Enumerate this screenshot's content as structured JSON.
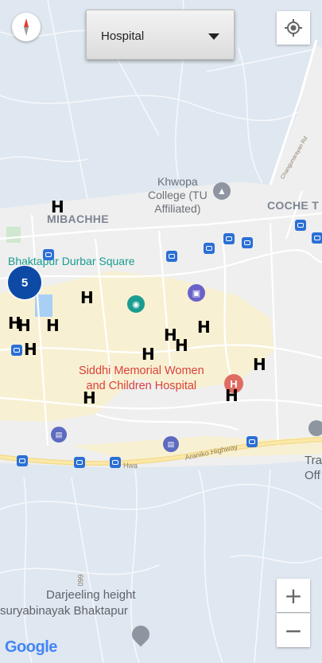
{
  "filter": {
    "selected": "Hospital"
  },
  "labels": {
    "mibachhe": "MIBACHHE",
    "coche": "COCHE T",
    "khwopa": [
      "Khwopa",
      "College (TU",
      "Affiliated)"
    ],
    "durbar": "Bhaktapur Durbar Square",
    "hospital": [
      "Siddhi Memorial Women",
      "and Children Hospital"
    ],
    "darjeeling": "Darjeeling height",
    "suryabinayak": "suryabinayak Bhaktapur",
    "tra": [
      "Tra",
      "Off"
    ],
    "araniko": "Araniko Highway",
    "changunarayan": "Changunarayan Rd",
    "hwa": "Hwa",
    "road_099": "099"
  },
  "cluster": {
    "count": "5"
  },
  "hospital_marker": "H",
  "controls": {
    "zoom_in": "+",
    "zoom_out": "−"
  },
  "attribution": "Google",
  "colors": {
    "cluster": "#0c4aa6",
    "bus_stop": "#2b6fd6",
    "teal_poi": "#1a9c90",
    "hospital_red": "#d9413b"
  }
}
